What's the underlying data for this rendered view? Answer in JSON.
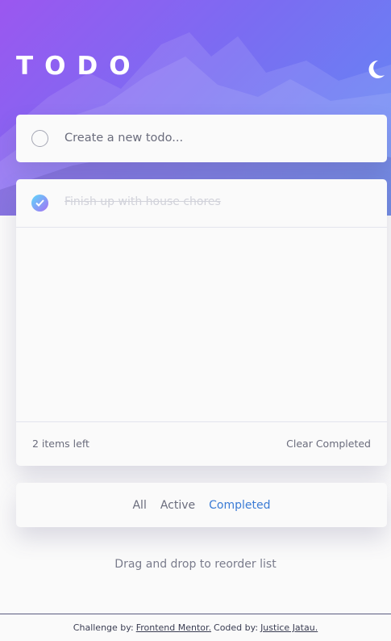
{
  "app": {
    "title": "TODO",
    "theme_icon": "moon-icon"
  },
  "new_todo": {
    "placeholder": "Create a new todo..."
  },
  "todos": [
    {
      "text": "Finish up with house chores",
      "completed": true
    }
  ],
  "list_footer": {
    "items_left": "2 items left",
    "clear_label": "Clear Completed"
  },
  "filters": [
    {
      "label": "All",
      "active": false
    },
    {
      "label": "Active",
      "active": false
    },
    {
      "label": "Completed",
      "active": true
    }
  ],
  "hint": "Drag and drop to reorder list",
  "attribution": {
    "challenge_prefix": "Challenge by:",
    "challenge_link": "Frontend Mentor.",
    "coded_prefix": "Coded by:",
    "coded_link": "Justice Jatau."
  },
  "colors": {
    "accent": "#3a7bd5",
    "header_gradient_start": "#9b57f0",
    "header_gradient_end": "#5f8cf4",
    "check_gradient_start": "#5ddafb",
    "check_gradient_end": "#a66ff3"
  }
}
